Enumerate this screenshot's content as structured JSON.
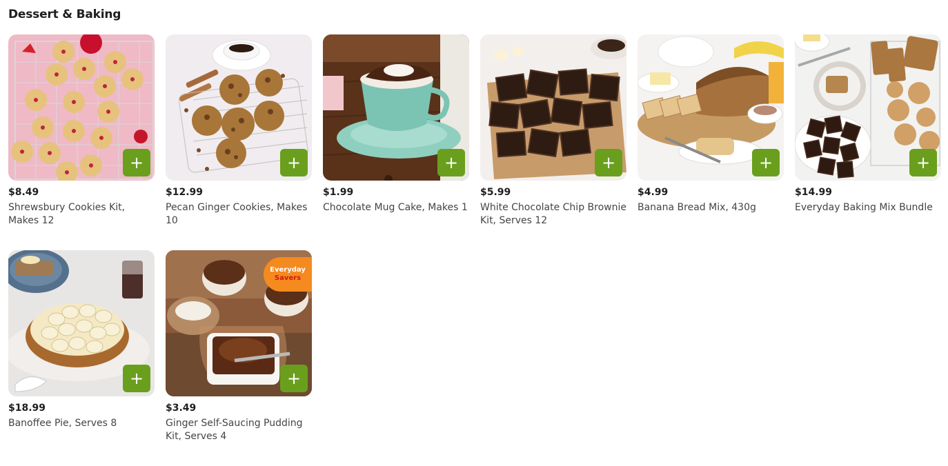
{
  "section": {
    "title": "Dessert & Baking"
  },
  "add_label": "+",
  "colors": {
    "add_button": "#6a9f1d",
    "badge_bg": "#f58a1f",
    "badge_text_accent": "#d4180e"
  },
  "products": [
    {
      "price": "$8.49",
      "name": "Shrewsbury Cookies Kit, Makes 12"
    },
    {
      "price": "$12.99",
      "name": "Pecan Ginger Cookies, Makes 10"
    },
    {
      "price": "$1.99",
      "name": "Chocolate Mug Cake, Makes 1"
    },
    {
      "price": "$5.99",
      "name": "White Chocolate Chip Brownie Kit, Serves 12"
    },
    {
      "price": "$4.99",
      "name": "Banana Bread Mix, 430g"
    },
    {
      "price": "$14.99",
      "name": "Everyday Baking Mix Bundle"
    },
    {
      "price": "$18.99",
      "name": "Banoffee Pie, Serves 8"
    },
    {
      "price": "$3.49",
      "name": "Ginger Self-Saucing Pudding Kit, Serves 4",
      "badge": {
        "line1": "Everyday",
        "line2": "Savers"
      }
    }
  ]
}
